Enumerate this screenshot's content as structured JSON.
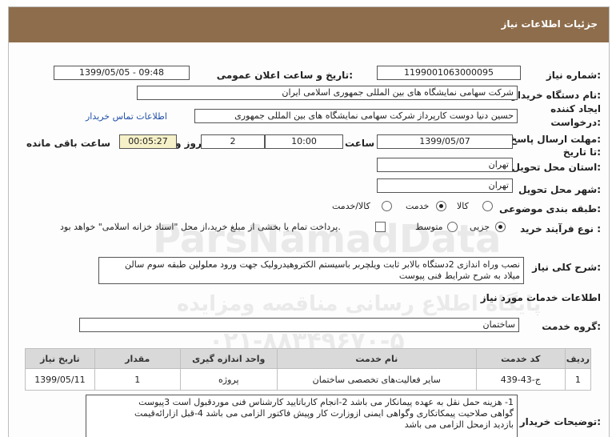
{
  "header": {
    "title": "جزئیات اطلاعات نیاز"
  },
  "fields": {
    "need_number_label": "شماره نیاز:",
    "need_number": "1199001063000095",
    "announce_label": "تاریخ و ساعت اعلان عمومی:",
    "announce_value": "1399/05/05 - 09:48",
    "buyer_label": "نام دستگاه خریدار:",
    "buyer_value": "شرکت سهامی نمایشگاه های بین المللی جمهوری اسلامی ایران",
    "creator_label_1": "ایجاد کننده",
    "creator_label_2": "درخواست:",
    "creator_value": "حسین دنیا دوست کارپرداز شرکت سهامی نمایشگاه های بین المللی جمهوری",
    "contact_link": "اطلاعات تماس خریدار",
    "deadline_label_1": "مهلت ارسال پاسخ:",
    "deadline_label_2": "تا تاریخ:",
    "deadline_date": "1399/05/07",
    "time_label": "ساعت",
    "deadline_time": "10:00",
    "days_value": "2",
    "days_label": "روز و",
    "remaining_value": "00:05:27",
    "remaining_label": "ساعت باقی مانده",
    "province_label": "استان محل تحویل:",
    "province_value": "تهران",
    "city_label": "شهر محل تحویل:",
    "city_value": "تهران",
    "category_label": "طبقه بندی موضوعی:",
    "category_options": [
      "کالا",
      "خدمت",
      "کالا/خدمت"
    ],
    "category_selected": "خدمت",
    "process_label": "نوع فرآیند خرید :",
    "process_options": [
      "جزیی",
      "متوسط"
    ],
    "process_selected": "جزیی",
    "payment_note": "پرداخت تمام یا بخشی از مبلغ خرید،از محل \"اسناد خزانه اسلامی\" خواهد بود."
  },
  "summary": {
    "label": "شرح کلی نیاز:",
    "text_line1": "نصب وراه اندازی 2دستگاه بالابر ثابت ویلچربر باسیستم الکتروهیدرولیک جهت ورود معلولین طبقه سوم سالن",
    "text_line2": "میلاد به شرح شرایط فنی پیوست"
  },
  "services": {
    "section_title": "اطلاعات خدمات مورد نیاز",
    "group_label": "گروه خدمت:",
    "group_value": "ساختمان",
    "columns": [
      "ردیف",
      "کد خدمت",
      "نام خدمت",
      "واحد اندازه گیری",
      "مقدار",
      "تاریخ نیاز"
    ],
    "rows": [
      {
        "row": "1",
        "code": "ج-43-439",
        "name": "سایر فعالیت‌های تخصصی ساختمان",
        "unit": "پروژه",
        "qty": "1",
        "date": "1399/05/11"
      }
    ]
  },
  "notes": {
    "label": "توضیحات خریدار:",
    "line1": "1- هزینه حمل نقل به عهده پیمانکار می باشد 2-انجام کارباتایید کارشناس فنی موردقبول است 3پیوست",
    "line2": "گواهی صلاحیت پیمکاتکاری وگواهی ایمنی ازوزارت کار وپیش فاکتور الزامی می باشد 4-قبل ازارائه‌قیمت",
    "line3": "بازدید ازمحل الزامی می باشد"
  },
  "watermark": {
    "line1": "ParsNamadData",
    "line2": "پایگاه اطلاع رسانی مناقصه ومزایده",
    "line3": "۰۲۱-۸۸۳۴۹۶۷۰-۵"
  }
}
